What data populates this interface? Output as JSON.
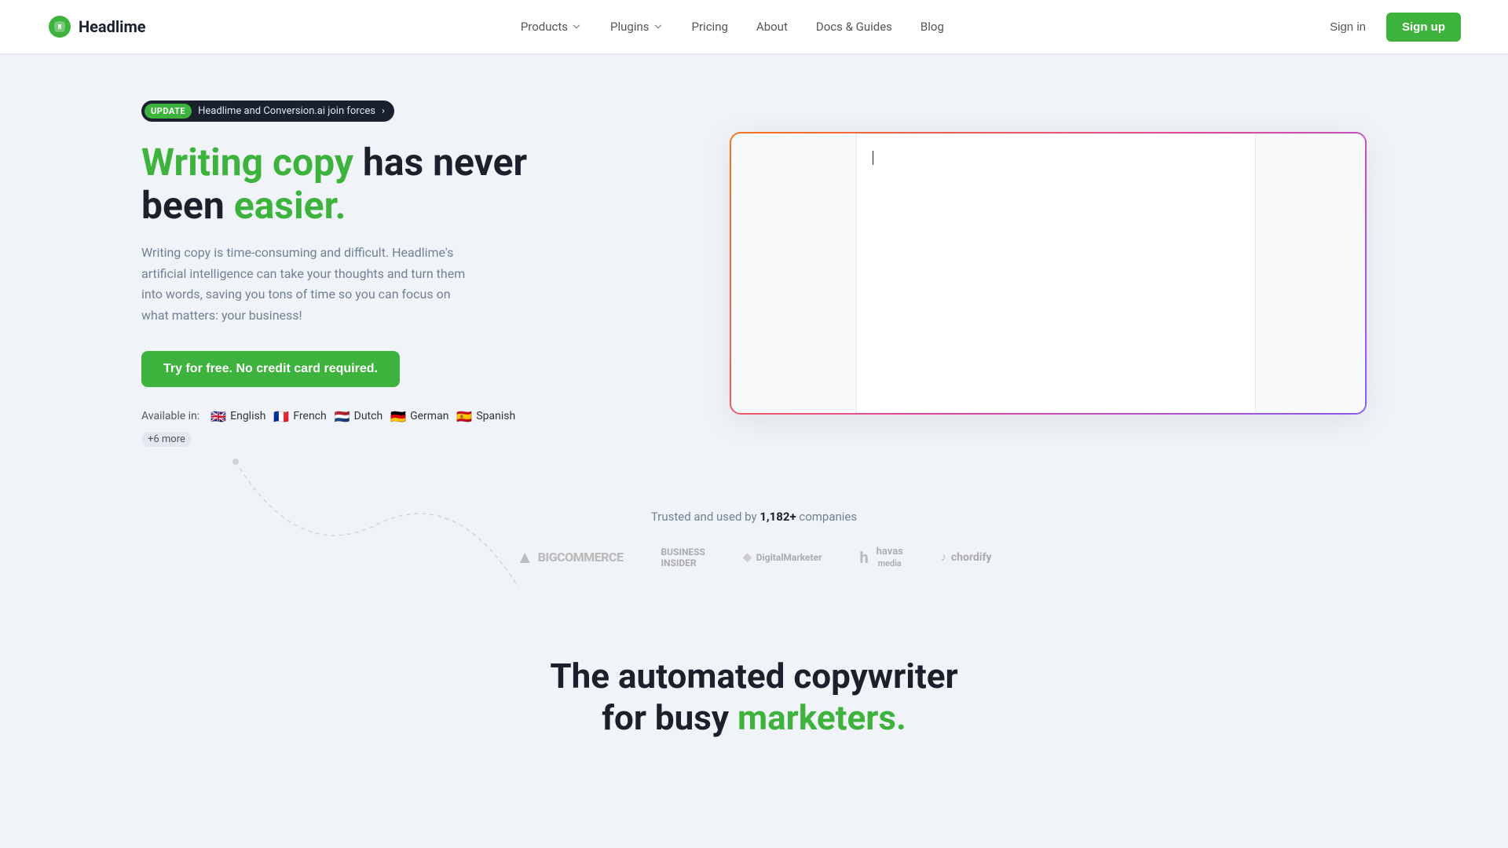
{
  "nav": {
    "logo_text": "Headlime",
    "links": [
      {
        "label": "Products",
        "has_dropdown": true
      },
      {
        "label": "Plugins",
        "has_dropdown": true
      },
      {
        "label": "Pricing",
        "has_dropdown": false
      },
      {
        "label": "About",
        "has_dropdown": false
      },
      {
        "label": "Docs & Guides",
        "has_dropdown": false
      },
      {
        "label": "Blog",
        "has_dropdown": false
      }
    ],
    "signin_label": "Sign in",
    "signup_label": "Sign up"
  },
  "hero": {
    "badge_label": "UPDATE",
    "badge_text": "Headlime and Conversion.ai join forces",
    "title_part1": "Writing copy ",
    "title_part2": "has never been ",
    "title_part3": "easier.",
    "description": "Writing copy is time-consuming and difficult. Headlime's artificial intelligence can take your thoughts and turn them into words, saving you tons of time so you can focus on what matters: your business!",
    "cta_label": "Try for free. No credit card required.",
    "available_label": "Available in:",
    "languages": [
      {
        "flag": "🇬🇧",
        "name": "English"
      },
      {
        "flag": "🇫🇷",
        "name": "French"
      },
      {
        "flag": "🇳🇱",
        "name": "Dutch"
      },
      {
        "flag": "🇩🇪",
        "name": "German"
      },
      {
        "flag": "🇪🇸",
        "name": "Spanish"
      }
    ],
    "more_label": "+6 more"
  },
  "trusted": {
    "text_before": "Trusted and used by ",
    "count": "1,182+",
    "text_after": " companies",
    "logos": [
      {
        "name": "BigCommerce",
        "display": "bigcommerce"
      },
      {
        "name": "Business Insider",
        "display": "BUSINESS\nINSIDER"
      },
      {
        "name": "DigitalMarketer",
        "display": "DigitalMarketer"
      },
      {
        "name": "Havas Media",
        "display": "havas media"
      },
      {
        "name": "Chordify",
        "display": "chordify"
      }
    ]
  },
  "bottom": {
    "title_part1": "The automated copywriter",
    "title_part2": "for busy ",
    "title_part3": "marketers."
  }
}
